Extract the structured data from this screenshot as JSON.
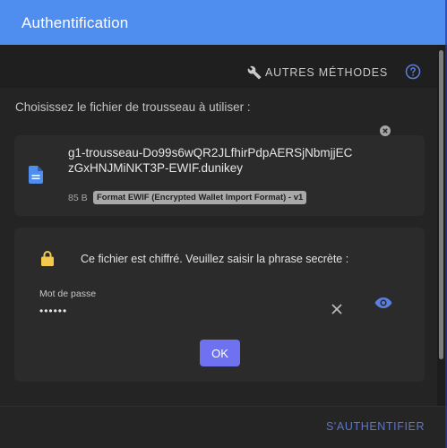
{
  "dialog": {
    "title": "Authentification"
  },
  "toolbar": {
    "methods_label": "AUTRES MÉTHODES",
    "help_icon": "help-circle-icon",
    "methods_icon": "wrench-icon"
  },
  "prompt": "Choisissez le fichier de trousseau à utiliser :",
  "file": {
    "name": "g1-trousseau-Do99s6wQR2JLfhirPdpAERSjNbmjjECzGxHNJMiNKT3P-EWIF.dunikey",
    "size": "85 B",
    "format": "Format EWIF (Encrypted Wallet Import Format) - v1",
    "icon": "file-document-icon"
  },
  "secret": {
    "message": "Ce fichier est chiffré. Veuillez saisir la phrase secrète :",
    "password_label": "Mot de passe",
    "password_value": "••••••",
    "ok_label": "OK",
    "icon": "lock-icon"
  },
  "footer": {
    "submit_label": "S'AUTHENTIFIER"
  },
  "colors": {
    "header": "#4f8def",
    "accent": "#6f72f0",
    "lock": "#f2c94c",
    "file_icon": "#4f8def"
  }
}
